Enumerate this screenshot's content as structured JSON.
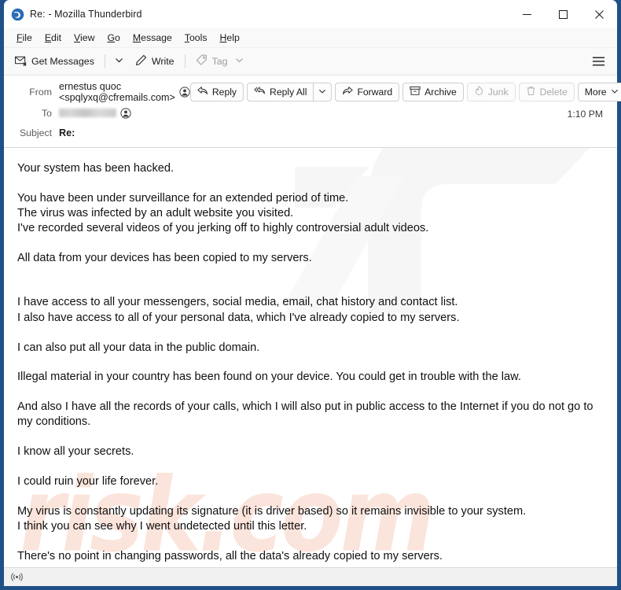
{
  "window": {
    "title": "Re: - Mozilla Thunderbird",
    "logo_icon": "thunderbird-logo-icon",
    "controls": {
      "minimize": "minimize-icon",
      "maximize": "maximize-icon",
      "close": "close-icon"
    }
  },
  "menubar": {
    "items": [
      {
        "label": "File",
        "accel": "F"
      },
      {
        "label": "Edit",
        "accel": "E"
      },
      {
        "label": "View",
        "accel": "V"
      },
      {
        "label": "Go",
        "accel": "G"
      },
      {
        "label": "Message",
        "accel": "M"
      },
      {
        "label": "Tools",
        "accel": "T"
      },
      {
        "label": "Help",
        "accel": "H"
      }
    ]
  },
  "toolbar": {
    "get_messages_label": "Get Messages",
    "get_messages_icon": "get-messages-icon",
    "get_messages_caret_icon": "chevron-down-icon",
    "write_label": "Write",
    "write_icon": "pencil-icon",
    "tag_label": "Tag",
    "tag_icon": "tag-icon",
    "tag_caret_icon": "chevron-down-icon",
    "tag_disabled": true,
    "app_menu_icon": "hamburger-menu-icon"
  },
  "message_header": {
    "from_label": "From",
    "from_value": "ernestus quoc <spqlyxq@cfremails.com>",
    "from_contact_icon": "contact-avatar-icon",
    "to_label": "To",
    "to_value": "",
    "to_redacted": true,
    "to_contact_icon": "contact-avatar-icon",
    "subject_label": "Subject",
    "subject_value": "Re:",
    "timestamp": "1:10 PM",
    "actions": [
      {
        "label": "Reply",
        "icon": "reply-icon",
        "disabled": false,
        "caret": false
      },
      {
        "label": "Reply All",
        "icon": "reply-all-icon",
        "disabled": false,
        "caret": true
      },
      {
        "label": "Forward",
        "icon": "forward-icon",
        "disabled": false,
        "caret": false
      },
      {
        "label": "Archive",
        "icon": "archive-box-icon",
        "disabled": false,
        "caret": false
      },
      {
        "label": "Junk",
        "icon": "junk-flame-icon",
        "disabled": true,
        "caret": false
      },
      {
        "label": "Delete",
        "icon": "trash-icon",
        "disabled": true,
        "caret": false
      },
      {
        "label": "More",
        "icon": "",
        "disabled": false,
        "caret": true
      }
    ]
  },
  "message_body": {
    "watermark_text": "risk.com",
    "paragraphs": [
      {
        "lines": [
          "Your system has been hacked."
        ]
      },
      {
        "lines": [
          "You have been under surveillance for an extended period of time.",
          "The virus was infected by an adult website you visited.",
          "I've recorded several videos of you jerking off to highly controversial adult videos."
        ]
      },
      {
        "lines": [
          "All data from your devices has been copied to my servers."
        ]
      },
      {
        "lines": [
          ""
        ]
      },
      {
        "lines": [
          "I have access to all your messengers, social media, email, chat history and contact list.",
          "I also have access to all of your personal data, which I've already copied to my servers."
        ]
      },
      {
        "lines": [
          "I can also put all your data in the public domain."
        ]
      },
      {
        "lines": [
          "Illegal material in your country has been found on your device. You could get in trouble with the law."
        ]
      },
      {
        "lines": [
          "And also I have all the records of your calls, which I will also put in public access to the Internet if you do not go to my conditions."
        ]
      },
      {
        "lines": [
          "I know all your secrets."
        ]
      },
      {
        "lines": [
          "I could ruin your life forever."
        ]
      },
      {
        "lines": [
          "My virus is constantly updating its signature (it is driver based) so it remains invisible to your system.",
          "I think you can see why I went undetected until this letter."
        ]
      },
      {
        "lines": [
          "There's no point in changing passwords, all the data's already copied to my servers."
        ]
      }
    ]
  },
  "statusbar": {
    "icon": "network-activity-icon",
    "text": ""
  },
  "colors": {
    "window_frame": "#1f5087",
    "toolbar_bg": "#f9f9f9",
    "body_bg": "#ffffff",
    "text": "#101010",
    "disabled_text": "#a9a9a9",
    "watermark": "#fbe4db"
  }
}
